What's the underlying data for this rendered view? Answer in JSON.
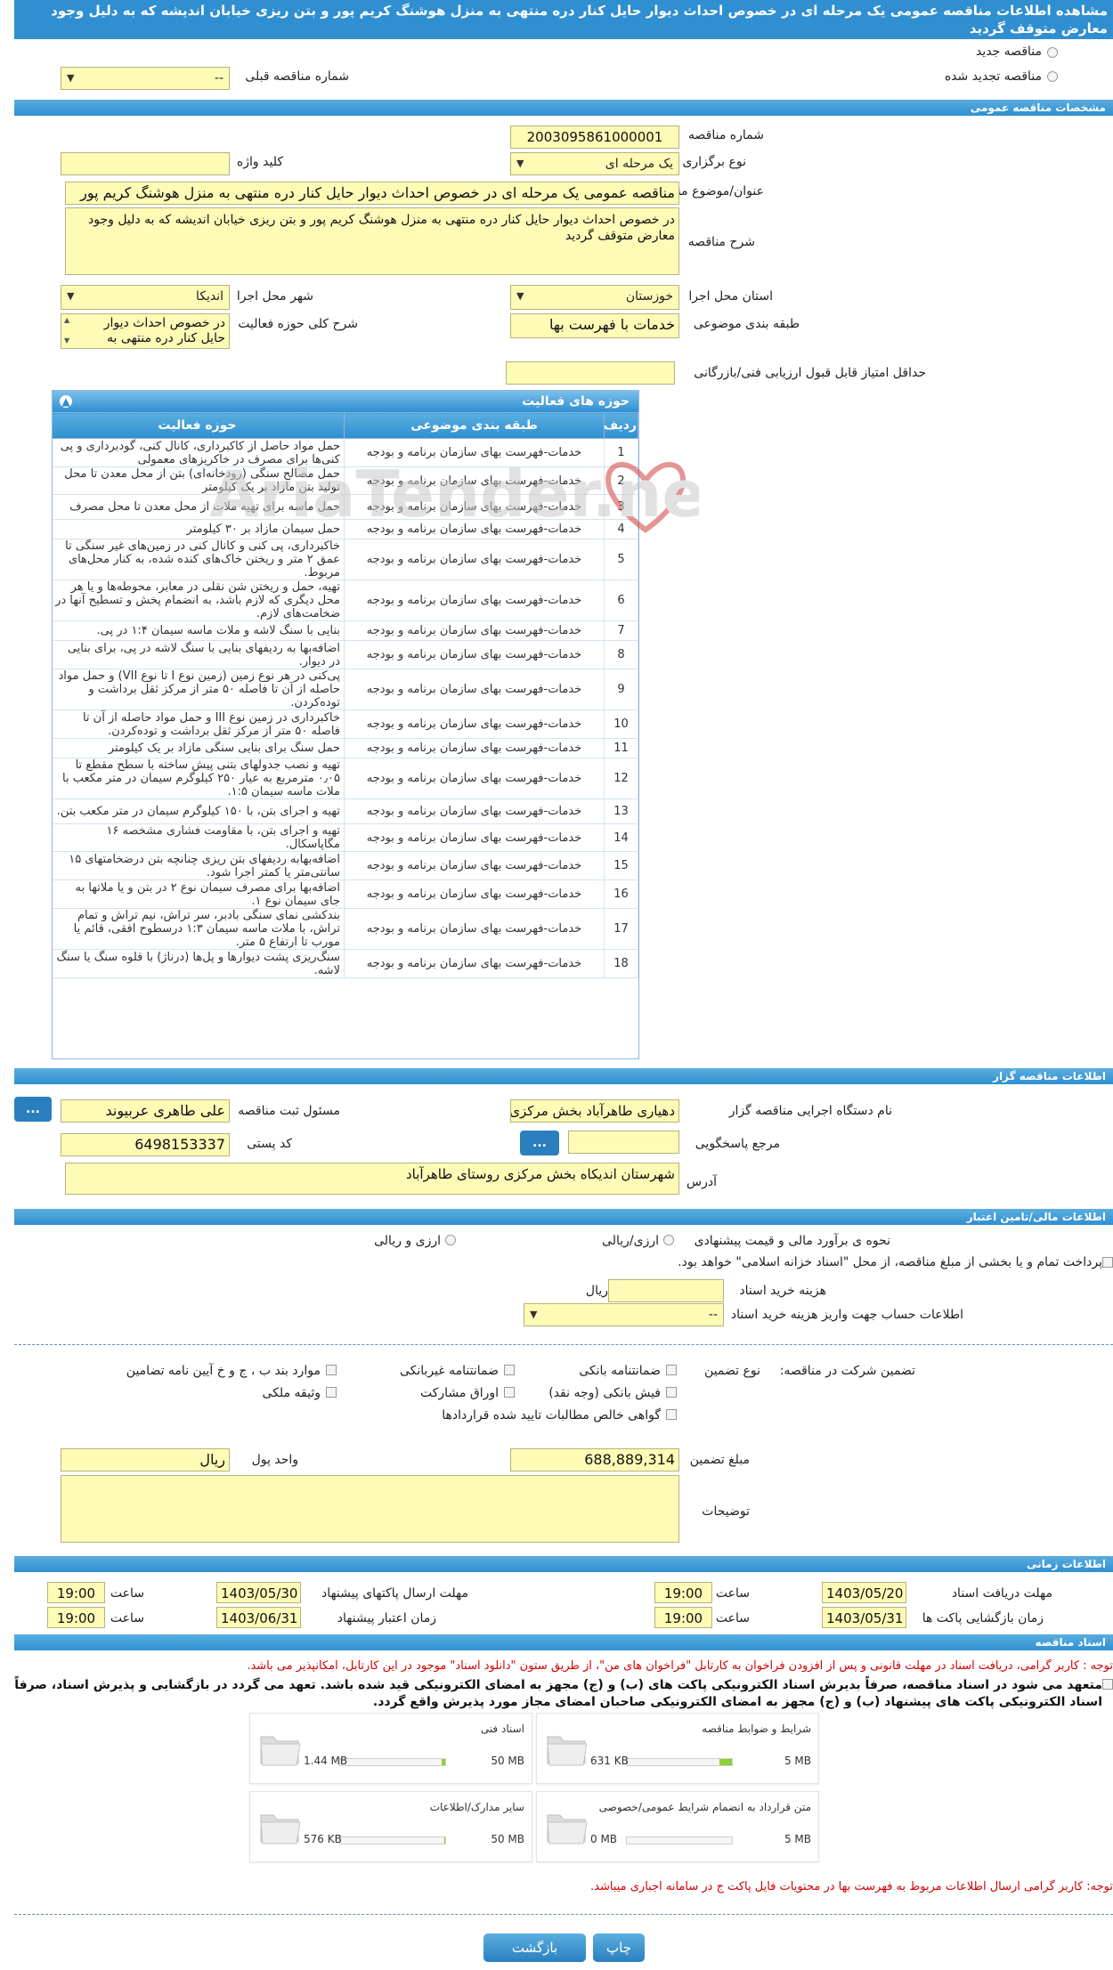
{
  "page_title": "مشاهده اطلاعات مناقصه عمومی یک مرحله ای در خصوص احداث دیوار حایل کنار دره منتهی به منزل هوشنگ کریم پور و بتن ریزی خیابان اندیشه که به دلیل وجود معارض متوقف گردید",
  "tender_type": {
    "new": "مناقصه جدید",
    "renewed": "مناقصه تجدید شده",
    "previous_label": "شماره مناقصه قبلی",
    "previous_value": "--"
  },
  "general": {
    "header": "مشخصات مناقصه عمومی",
    "number_label": "شماره مناقصه",
    "number": "2003095861000001",
    "hold_type_label": "نوع برگزاری",
    "hold_type": "یک مرحله ای",
    "keyword_label": "کلید واژه",
    "keyword": "",
    "subject_label": "عنوان/موضوع مناقصه",
    "subject": "مناقصه عمومی یک مرحله ای در خصوص  احداث دیوار حایل کنار دره منتهی به منزل هوشنگ کریم پور",
    "desc_label": "شرح مناقصه",
    "desc": "در خصوص  احداث دیوار حایل کنار دره منتهی به منزل هوشنگ کریم پور و بتن ریزی خیابان اندیشه که به دلیل وجود معارض متوقف گردید",
    "province_label": "استان محل اجرا",
    "province": "خوزستان",
    "city_label": "شهر محل اجرا",
    "city": "اندیکا",
    "category_label": "طبقه بندی موضوعی",
    "category": "خدمات با فهرست بها",
    "activity_desc_label": "شرح کلی حوزه فعالیت",
    "activity_desc": "در خصوص  احداث دیوار حایل کنار دره منتهی به",
    "min_score_label": "حداقل امتیاز قابل قبول ارزیابی فنی/بازرگانی",
    "min_score": ""
  },
  "activities": {
    "title": "حوزه های فعالیت",
    "columns": [
      "ردیف",
      "طبقه بندی موضوعی",
      "حوزه فعالیت"
    ],
    "rows": [
      [
        "1",
        "خدمات-فهرست بهای سازمان برنامه و بودجه",
        "حمل مواد حاصل از کاکبرداری، کانال کنی، گودبرداری و پی کنی‌ها برای مصرف در خاکریزهای معمولی"
      ],
      [
        "2",
        "خدمات-فهرست بهای سازمان برنامه و بودجه",
        "حمل مصالح سنگی (رودخانه‌ای) بتن از محل معدن تا محل تولید بتن مازاد بر یک کیلومتر"
      ],
      [
        "3",
        "خدمات-فهرست بهای سازمان برنامه و بودجه",
        "حمل ماسه برای تهیه ملات از محل معدن تا محل مصرف"
      ],
      [
        "4",
        "خدمات-فهرست بهای سازمان برنامه و بودجه",
        "حمل سیمان مازاد بر ۳۰ کیلومتر"
      ],
      [
        "5",
        "خدمات-فهرست بهای سازمان برنامه و بودجه",
        "خاکبرداری، پی کنی و کانال کنی در زمین‌های غیر سنگی تا عمق ۲ متر و ریختن خاک‌های کنده شده، به کنار محل‌های مربوط."
      ],
      [
        "6",
        "خدمات-فهرست بهای سازمان برنامه و بودجه",
        "تهیه، حمل و ریختن شن نقلی در معابر، محوطه‌ها و یا هر محل دیگری که لازم باشد، به انضمام پخش و تسطیح آنها در ضخامت‌های لازم."
      ],
      [
        "7",
        "خدمات-فهرست بهای سازمان برنامه و بودجه",
        "بنایی با سنگ لاشه و ملات ماسه سیمان ۱:۴ در پی."
      ],
      [
        "8",
        "خدمات-فهرست بهای سازمان برنامه و بودجه",
        "اضافه‌بها به ردیفهای بنایی با سنگ لاشه در پی، برای بنایی در دیوار."
      ],
      [
        "9",
        "خدمات-فهرست بهای سازمان برنامه و بودجه",
        "پی‌کنی در هر نوع زمین (زمین نوع I تا نوع VII) و حمل مواد حاصله از آن تا فاصله ۵۰ متر از مرکز ثقل برداشت و توده‌کردن."
      ],
      [
        "10",
        "خدمات-فهرست بهای سازمان برنامه و بودجه",
        "خاکبرداری در زمین نوع III و حمل مواد حاصله از آن تا فاصله ۵۰ متر از مرکز ثقل برداشت و توده‌کردن."
      ],
      [
        "11",
        "خدمات-فهرست بهای سازمان برنامه و بودجه",
        "حمل سنگ برای بنایی سنگی مازاد بر یک کیلومتر"
      ],
      [
        "12",
        "خدمات-فهرست بهای سازمان برنامه و بودجه",
        "تهیه و نصب جدولهای بتنی پیش ساخته با سطح مقطع تا ۰٫۰۵ مترمربع به عیار ۲۵۰ کیلوگرم سیمان در متر مکعب با ملات ماسه سیمان ۱:۵."
      ],
      [
        "13",
        "خدمات-فهرست بهای سازمان برنامه و بودجه",
        "تهیه و اجرای بتن، با ۱۵۰ کیلوگرم سیمان در متر مکعب بتن."
      ],
      [
        "14",
        "خدمات-فهرست بهای سازمان برنامه و بودجه",
        "تهیه و اجرای بتن، با مقاومت فشاری مشخصه ۱۶ مگاپاسکال."
      ],
      [
        "15",
        "خدمات-فهرست بهای سازمان برنامه و بودجه",
        "اضافه‌بهابه ردیفهای بتن ریزی چنانچه بتن درضخامتهای ۱۵ سانتی‌متر یا کمتر اجرا شود."
      ],
      [
        "16",
        "خدمات-فهرست بهای سازمان برنامه و بودجه",
        "اضافه‌بها برای مصرف سیمان نوع ۲ در بتن و یا ملاتها به جای سیمان نوع ۱."
      ],
      [
        "17",
        "خدمات-فهرست بهای سازمان برنامه و بودجه",
        "بندکشی نمای سنگی بادبر، سر تراش، نیم تراش و تمام تراش، با ملات ماسه سیمان ۱:۳ درسطوح افقی، قائم یا مورب تا ارتفاع ۵ متر."
      ],
      [
        "18",
        "خدمات-فهرست بهای سازمان برنامه و بودجه",
        "سنگ‌ریزی پشت دیوارها و پل‌ها (درناژ) با قلوه سنگ یا سنگ لاشه."
      ]
    ]
  },
  "organizer": {
    "header": "اطلاعات مناقصه گزار",
    "org_label": "نام دستگاه اجرایی مناقصه گزار",
    "org": "دهیاری طاهرآباد بخش مرکزی",
    "officer_label": "مسئول ثبت مناقصه",
    "officer": "علی طاهری عربیوند",
    "ref_label": "مرجع پاسخگویی",
    "ref": "",
    "postal_label": "کد پستی",
    "postal": "6498153337",
    "address_label": "آدرس",
    "address": "شهرستان اندیکاه بخش مرکزی  روستای طاهرآباد",
    "dots": "..."
  },
  "finance": {
    "header": "اطلاعات مالی/تامین اعتبار",
    "estimate_label": "نحوه ی برآورد مالی و قیمت پیشنهادی",
    "opt_rial": "ارزی/ریالی",
    "opt_currency": "ارزی و ریالی",
    "partial_pay": "پرداخت تمام و یا بخشی از مبلغ مناقصه، از محل \"اسناد خزانه اسلامی\" خواهد بود.",
    "doc_cost_label": "هزینه خرید اسناد",
    "doc_cost": "",
    "doc_cost_unit": "ریال",
    "account_label": "اطلاعات حساب جهت واریز هزینه خرید اسناد",
    "account": "--"
  },
  "guarantee": {
    "label": "تضمین شرکت در مناقصه:",
    "type_label": "نوع تضمین",
    "opts": [
      "ضمانتنامه بانکی",
      "ضمانتنامه غیربانکی",
      "موارد بند ب ، ج و خ آیین نامه تضامین",
      "فیش بانکی (وجه نقد)",
      "اوراق مشارکت",
      "وثیقه ملکی",
      "گواهی خالص مطالبات تایید شده قراردادها"
    ],
    "amount_label": "مبلغ تضمین",
    "amount": "688,889,314",
    "unit_label": "واحد پول",
    "unit": "ریال",
    "notes_label": "توضیحات",
    "notes": ""
  },
  "timing": {
    "header": "اطلاعات زمانی",
    "doc_deadline_label": "مهلت دریافت اسناد",
    "doc_deadline_date": "1403/05/20",
    "time_label": "ساعت",
    "doc_deadline_time": "19:00",
    "send_deadline_label": "مهلت ارسال پاکتهای پیشنهاد",
    "send_deadline_date": "1403/05/30",
    "send_deadline_time": "19:00",
    "open_label": "زمان بازگشایی پاکت ها",
    "open_date": "1403/05/31",
    "open_time": "19:00",
    "validity_label": "زمان اعتبار پیشنهاد",
    "validity_date": "1403/06/31",
    "validity_time": "19:00"
  },
  "documents": {
    "header": "اسناد مناقصه",
    "note1": "توجه : کاربر گرامی، دریافت اسناد در مهلت قانونی و پس از افزودن فراخوان به کارتابل \"فراخوان های من\"، از طریق ستون \"دانلود اسناد\" موجود در این کارتابل، امکانپذیر می باشد.",
    "commit": "متعهد می شود در اسناد مناقصه، صرفاً بدیرش اسناد الکترونیکی پاکت های (ب) و (ج) مجهز به امضای الکترونیکی قید شده باشد. تعهد می گردد در بازگشایی و پذیرش اسناد، صرفاً اسناد الکترونیکی پاکت های پیشنهاد (ب) و (ج) مجهز به امضای الکترونیکی صاحبان امضای مجاز مورد پذیرش واقع گردد.",
    "files": [
      {
        "title": "شرایط و ضوابط مناقصه",
        "size": "631 KB",
        "max": "5 MB",
        "fill_pct": 12
      },
      {
        "title": "اسناد فنی",
        "size": "1.44 MB",
        "max": "50 MB",
        "fill_pct": 3
      },
      {
        "title": "متن قرارداد به انضمام شرایط عمومی/خصوصی",
        "size": "0 MB",
        "max": "5 MB",
        "fill_pct": 0
      },
      {
        "title": "سایر مدارک/اطلاعات",
        "size": "576 KB",
        "max": "50 MB",
        "fill_pct": 1
      }
    ],
    "note2": "توجه: کاربر گرامی ارسال اطلاعات مربوط به فهرست بها در محتویات فایل پاکت ج در سامانه اجباری میباشد."
  },
  "actions": {
    "print": "چاپ",
    "back": "بازگشت"
  },
  "watermark": "AriaTender.neT",
  "colors": {
    "header": "#2f8fd0",
    "field": "#fdfbb6",
    "note": "#d40000"
  }
}
